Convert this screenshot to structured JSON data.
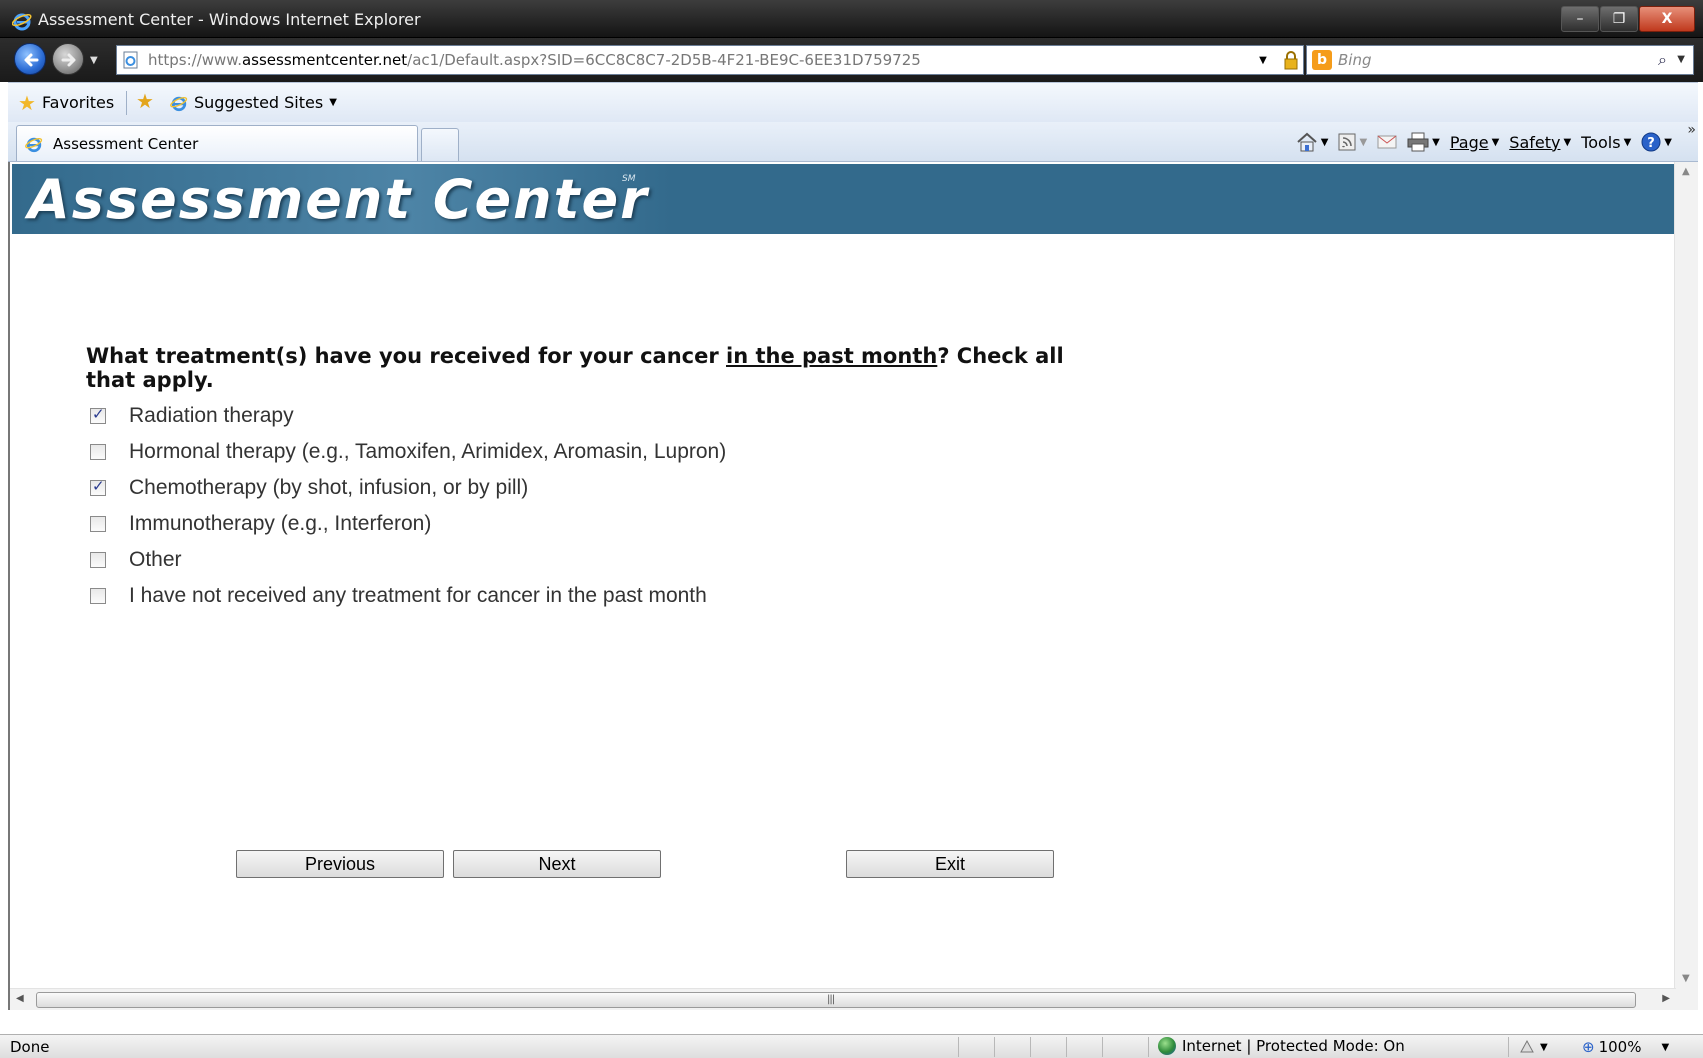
{
  "window": {
    "title": "Assessment Center - Windows Internet Explorer",
    "minimize": "–",
    "maximize": "❐",
    "close": "X"
  },
  "address": {
    "url_prefix": "https://www.",
    "url_domain": "assessmentcenter.net",
    "url_path": "/ac1/Default.aspx?SID=6CC8C8C7-2D5B-4F21-BE9C-6EE31D759725",
    "search_placeholder": "Bing"
  },
  "favorites_bar": {
    "favorites_label": "Favorites",
    "suggested_sites_label": "Suggested Sites"
  },
  "tabs": [
    {
      "label": "Assessment Center"
    }
  ],
  "command_bar": {
    "page_label": "Page",
    "safety_label": "Safety",
    "tools_label": "Tools"
  },
  "banner": {
    "brand": "Assessment Center",
    "mark": "SM"
  },
  "question": {
    "text_before": "What treatment(s) have you received for your cancer ",
    "text_underlined": "in the past month",
    "text_after": "? Check all that apply."
  },
  "options": [
    {
      "label": "Radiation therapy",
      "checked": true
    },
    {
      "label": "Hormonal therapy (e.g., Tamoxifen, Arimidex, Aromasin, Lupron)",
      "checked": false
    },
    {
      "label": "Chemotherapy (by shot, infusion, or by pill)",
      "checked": true
    },
    {
      "label": "Immunotherapy (e.g., Interferon)",
      "checked": false
    },
    {
      "label": "Other",
      "checked": false
    },
    {
      "label": "I have not received any treatment for cancer in the past month",
      "checked": false
    }
  ],
  "buttons": {
    "previous": "Previous",
    "next": "Next",
    "exit": "Exit"
  },
  "status": {
    "done": "Done",
    "zone": "Internet | Protected Mode: On",
    "zoom": "100%"
  },
  "colors": {
    "banner": "#336a8c",
    "checkmark": "#2a3b8f"
  }
}
